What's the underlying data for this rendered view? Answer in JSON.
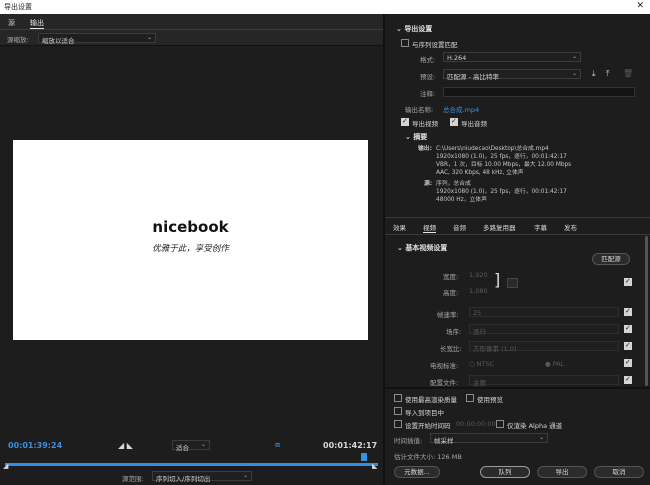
{
  "window": {
    "title": "导出设置",
    "close": "✕"
  },
  "left": {
    "tabs": [
      {
        "label": "源"
      },
      {
        "label": "输出"
      }
    ],
    "source_scale_label": "源缩放:",
    "source_scale_value": "缩放以适合",
    "preview_logo": "nicebook",
    "preview_slogan": "优雅于此，享受创作",
    "timecode_in": "00:01:39:24",
    "timecode_out": "00:01:42:17",
    "fit_value": "适合",
    "source_range_label": "源范围:",
    "source_range_value": "序列切入/序列切出"
  },
  "export": {
    "section_title": "导出设置",
    "match_sequence": "与序列设置匹配",
    "format_label": "格式:",
    "format_value": "H.264",
    "preset_label": "预设:",
    "preset_value": "匹配源 - 高比特率",
    "comment_label": "注释:",
    "comment_value": "",
    "output_name_label": "输出名称:",
    "output_name_value": "总合成.mp4",
    "export_video": "导出视频",
    "export_audio": "导出音频",
    "summary_title": "摘要",
    "summary_output_label": "输出:",
    "summary_output_lines": [
      "C:\\Users\\niudecao\\Desktop\\总合成.mp4",
      "1920x1080 (1.0)，25 fps，逐行，00:01:42:17",
      "VBR，1 次，目标 10.00 Mbps，最大 12.00 Mbps",
      "AAC, 320 Kbps, 48 kHz, 立体声"
    ],
    "summary_source_label": "源:",
    "summary_source_lines": [
      "序列，总合成",
      "1920x1080 (1.0)，25 fps，逐行，00:01:42:17",
      "48000 Hz，立体声"
    ]
  },
  "settings_tabs": [
    {
      "label": "效果"
    },
    {
      "label": "视频"
    },
    {
      "label": "音频"
    },
    {
      "label": "多路复用器"
    },
    {
      "label": "字幕"
    },
    {
      "label": "发布"
    }
  ],
  "video": {
    "section_title": "基本视频设置",
    "match_source_button": "匹配源",
    "width_label": "宽度:",
    "width_value": "1,920",
    "height_label": "高度:",
    "height_value": "1,080",
    "framerate_label": "帧速率:",
    "framerate_value": "25",
    "field_order_label": "场序:",
    "field_order_value": "逐行",
    "aspect_label": "长宽比:",
    "aspect_value": "方形像素 (1.0)",
    "tv_standard_label": "电视标准:",
    "tv_ntsc": "NTSC",
    "tv_pal": "PAL",
    "profile_label": "配置文件:",
    "profile_value": "主要"
  },
  "bottom": {
    "max_render_quality": "使用最高渲染质量",
    "use_previews": "使用预览",
    "import_into_project": "导入到项目中",
    "set_start_timecode": "设置开始时间码",
    "start_timecode_value": "00:00:00:00",
    "render_alpha_only": "仅渲染 Alpha 通道",
    "time_interpolation_label": "时间插值:",
    "time_interpolation_value": "帧采样",
    "estimated_size": "估计文件大小: 126 MB",
    "metadata_button": "元数据...",
    "queue_button": "队列",
    "export_button": "导出",
    "cancel_button": "取消"
  }
}
